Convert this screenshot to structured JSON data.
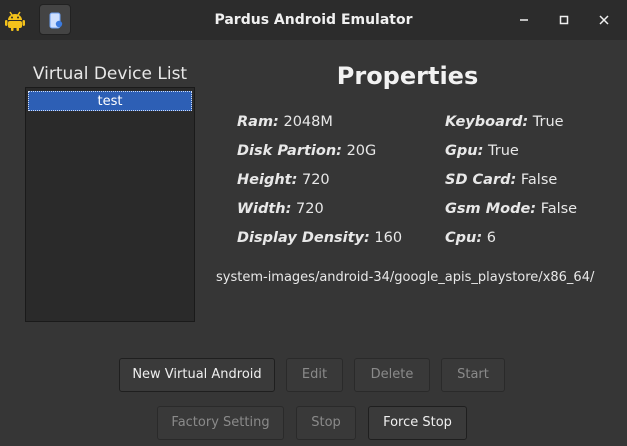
{
  "window": {
    "title": "Pardus Android Emulator",
    "app_icon": "android-robot-icon",
    "toolbar_icon": "emulator-device-icon",
    "controls": [
      "minimize-icon",
      "maximize-icon",
      "close-icon"
    ]
  },
  "device_panel": {
    "title": "Virtual Device List",
    "items": [
      "test"
    ]
  },
  "properties": {
    "heading": "Properties",
    "left": [
      {
        "key": "Ram:",
        "value": "2048M"
      },
      {
        "key": "Disk Partion:",
        "value": "20G"
      },
      {
        "key": "Height:",
        "value": "720"
      },
      {
        "key": "Width:",
        "value": "720"
      },
      {
        "key": "Display Density:",
        "value": "160"
      }
    ],
    "right": [
      {
        "key": "Keyboard:",
        "value": "True"
      },
      {
        "key": "Gpu:",
        "value": "True"
      },
      {
        "key": "SD Card:",
        "value": "False"
      },
      {
        "key": "Gsm Mode:",
        "value": "False"
      },
      {
        "key": "Cpu:",
        "value": "6"
      }
    ],
    "system_image": "system-images/android-34/google_apis_playstore/x86_64/"
  },
  "buttons": {
    "new_virtual_android": "New Virtual Android",
    "edit": "Edit",
    "delete": "Delete",
    "start": "Start",
    "factory_setting": "Factory Setting",
    "stop": "Stop",
    "force_stop": "Force Stop"
  },
  "colors": {
    "window_bg": "#363636",
    "titlebar_bg": "#2c2c2c",
    "selection": "#2d5fb5",
    "app_icon": "#f3c21b"
  }
}
